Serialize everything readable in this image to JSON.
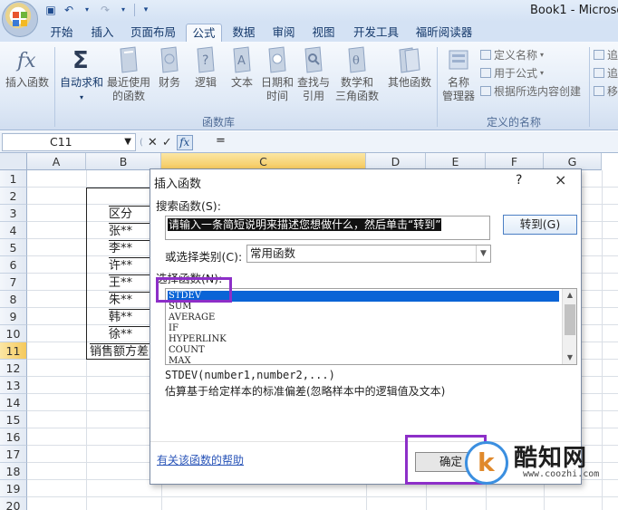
{
  "app": {
    "title": "Book1 - Microso",
    "quick_access": [
      "save-icon",
      "undo-icon",
      "redo-icon"
    ]
  },
  "ribbon": {
    "tabs": [
      "开始",
      "插入",
      "页面布局",
      "公式",
      "数据",
      "审阅",
      "视图",
      "开发工具",
      "福昕阅读器"
    ],
    "active_tab": "公式",
    "function_library": {
      "insert_function": "插入函数",
      "autosum": "自动求和",
      "recent_line1": "最近使用",
      "recent_line2": "的函数",
      "financial": "财务",
      "logical": "逻辑",
      "text": "文本",
      "datetime_line1": "日期和",
      "datetime_line2": "时间",
      "lookup_line1": "查找与",
      "lookup_line2": "引用",
      "math_line1": "数学和",
      "math_line2": "三角函数",
      "other": "其他函数",
      "group_label": "函数库"
    },
    "defined_names": {
      "name_manager_line1": "名称",
      "name_manager_line2": "管理器",
      "define_name": "定义名称",
      "use_in_formula": "用于公式",
      "create_from_selection": "根据所选内容创建",
      "group_label": "定义的名称"
    },
    "right_cut": [
      "追",
      "追",
      "移"
    ]
  },
  "formula_bar": {
    "name_box": "C11",
    "formula": "="
  },
  "sheet": {
    "columns": [
      "A",
      "B",
      "C",
      "D",
      "E",
      "F",
      "G"
    ],
    "selected_column": "C",
    "rows": [
      "1",
      "2",
      "3",
      "4",
      "5",
      "6",
      "7",
      "8",
      "9",
      "10",
      "11",
      "12",
      "13",
      "14",
      "15",
      "16",
      "17",
      "18",
      "19",
      "20"
    ],
    "selected_row": "11",
    "b_cells": [
      {
        "row": 3,
        "text": "区分"
      },
      {
        "row": 4,
        "text": "张**"
      },
      {
        "row": 5,
        "text": "李**"
      },
      {
        "row": 6,
        "text": "许**"
      },
      {
        "row": 7,
        "text": "王**"
      },
      {
        "row": 8,
        "text": "朱**"
      },
      {
        "row": 9,
        "text": "韩**"
      },
      {
        "row": 10,
        "text": "徐**"
      },
      {
        "row": 11,
        "text": "销售额方差"
      }
    ]
  },
  "dialog": {
    "title": "插入函数",
    "help": "?",
    "close": "×",
    "search_label": "搜索函数(S):",
    "search_value": "请输入一条简短说明来描述您想做什么，然后单击“转到”",
    "go_button": "转到(G)",
    "category_label": "或选择类别(C):",
    "category_value": "常用函数",
    "function_list_label": "选择函数(N):",
    "functions": [
      "STDEV",
      "SUM",
      "AVERAGE",
      "IF",
      "HYPERLINK",
      "COUNT",
      "MAX"
    ],
    "selected_function": "STDEV",
    "syntax": "STDEV(number1,number2,...)",
    "description": "估算基于给定样本的标准偏差(忽略样本中的逻辑值及文本)",
    "help_link": "有关该函数的帮助",
    "ok_button": "确定"
  },
  "watermark": {
    "name": "酷知网",
    "url": "www.coozhi.com"
  }
}
